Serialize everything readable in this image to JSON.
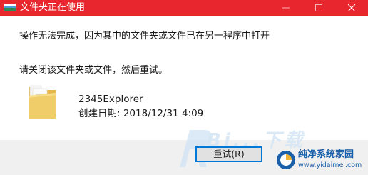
{
  "dialog": {
    "title": "文件夹正在使用",
    "message": "操作无法完成，因为其中的文件夹或文件已在另一程序中打开",
    "instruction": "请关闭该文件夹或文件，然后重试。"
  },
  "file": {
    "name": "2345Explorer",
    "created": "创建日期: 2018/12/31 4:09"
  },
  "buttons": {
    "retry_label": "重试(R)"
  },
  "watermark": {
    "site_name": "纯净系统家园",
    "site_url": "www.yidaimei.com",
    "logo_text": "Bi...下载"
  },
  "colors": {
    "titlebar": "#e8262d",
    "accent": "#0078d7",
    "footer": "#f0f0f0"
  },
  "icons": {
    "app": "folder-app-icon",
    "minimize": "minimize-icon",
    "maximize": "maximize-icon",
    "close": "close-icon",
    "file": "folder-icon"
  }
}
